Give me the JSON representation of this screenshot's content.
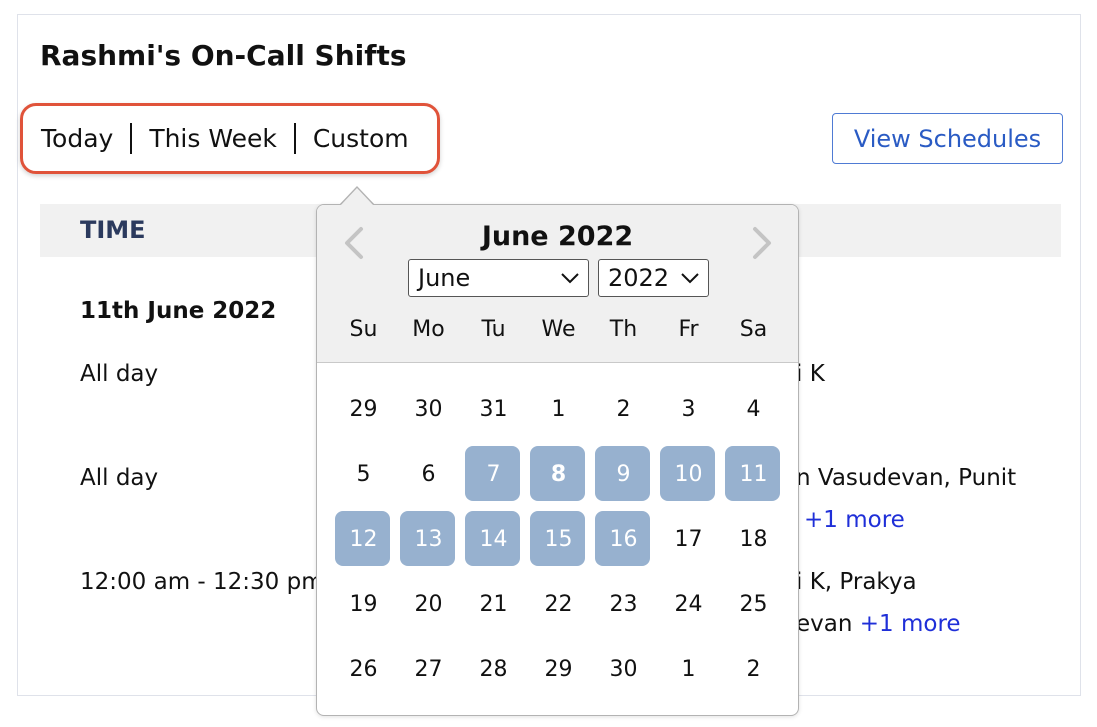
{
  "page": {
    "title": "Rashmi's On-Call Shifts",
    "range_options": [
      "Today",
      "This Week",
      "Custom"
    ],
    "view_schedules_label": "View Schedules"
  },
  "table": {
    "header_time": "TIME",
    "date_heading": "11th June 2022",
    "rows": [
      {
        "time": "All day",
        "who_line1": "i K",
        "who_line2": "",
        "more": ""
      },
      {
        "time": "All day",
        "who_line1": "n Vasudevan, Punit",
        "who_line2": "",
        "more": "+1 more"
      },
      {
        "time": "12:00 am - 12:30 pm",
        "who_line1": "i K, Prakya",
        "who_line2": "evan",
        "more": "+1 more"
      }
    ]
  },
  "datepicker": {
    "month_title": "June 2022",
    "month_select_value": "June",
    "year_select_value": "2022",
    "weekdays": [
      "Su",
      "Mo",
      "Tu",
      "We",
      "Th",
      "Fr",
      "Sa"
    ],
    "weeks": [
      [
        "29",
        "30",
        "31",
        "1",
        "2",
        "3",
        "4"
      ],
      [
        "5",
        "6",
        "7",
        "8",
        "9",
        "10",
        "11"
      ],
      [
        "12",
        "13",
        "14",
        "15",
        "16",
        "17",
        "18"
      ],
      [
        "19",
        "20",
        "21",
        "22",
        "23",
        "24",
        "25"
      ],
      [
        "26",
        "27",
        "28",
        "29",
        "30",
        "1",
        "2"
      ]
    ],
    "selected_range": [
      "7",
      "16"
    ],
    "today": "8",
    "colors": {
      "range_fill": "#97b1cf",
      "highlight_border": "#e0533a",
      "link": "#1f2fd8"
    },
    "icons": {
      "prev": "chevron-left-icon",
      "next": "chevron-right-icon",
      "select": "chevron-down-icon"
    }
  }
}
